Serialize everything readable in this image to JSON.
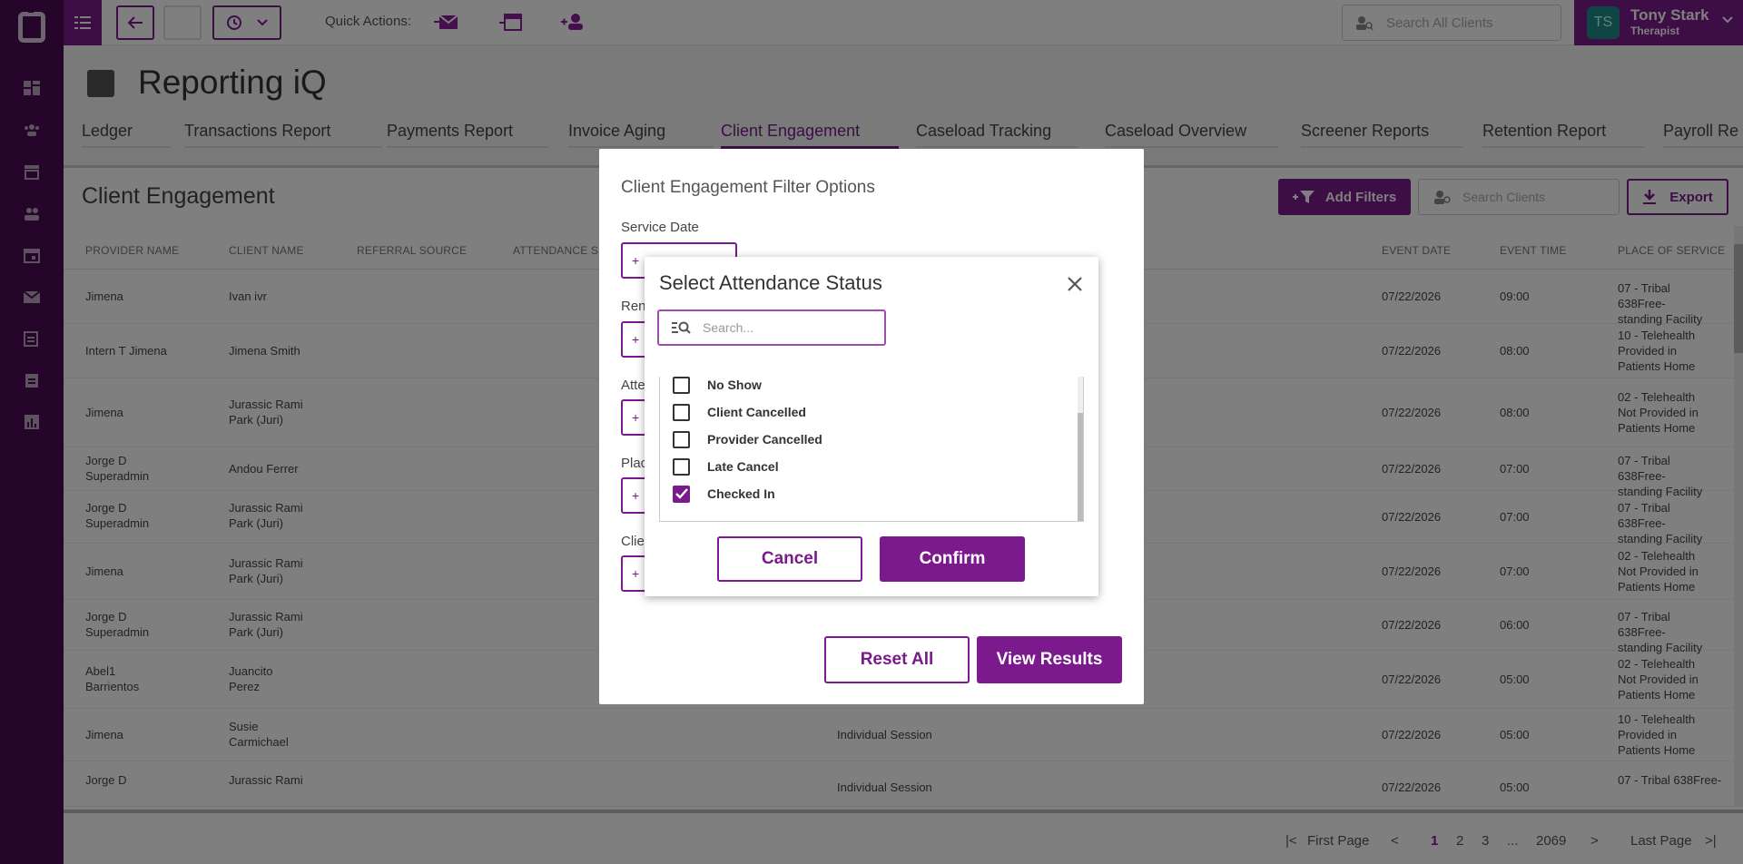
{
  "topbar": {
    "quick_actions_label": "Quick Actions:",
    "search_placeholder": "Search All Clients",
    "user": {
      "initials": "TS",
      "name": "Tony Stark",
      "role": "Therapist"
    }
  },
  "page": {
    "title": "Reporting iQ",
    "tabs": [
      "Ledger",
      "Transactions Report",
      "Payments Report",
      "Invoice Aging",
      "Client Engagement",
      "Caseload Tracking",
      "Caseload Overview",
      "Screener Reports",
      "Retention Report",
      "Payroll Re"
    ],
    "active_tab": "Client Engagement"
  },
  "card": {
    "title": "Client Engagement",
    "add_filters_label": "Add Filters",
    "search_placeholder": "Search Clients",
    "export_label": "Export"
  },
  "table": {
    "headers": [
      "PROVIDER NAME",
      "CLIENT NAME",
      "REFERRAL SOURCE",
      "ATTENDANCE S",
      "EVENT DATE",
      "EVENT TIME",
      "PLACE OF SERVICE"
    ],
    "rows": [
      {
        "provider": "Jimena",
        "client": "Ivan ivr",
        "event": "",
        "date": "07/22/2026",
        "time": "09:00",
        "place": "07 - Tribal 638Free-standing Facility"
      },
      {
        "provider": "Intern T Jimena",
        "client": "Jimena Smith",
        "event": "",
        "date": "07/22/2026",
        "time": "08:00",
        "place": "10 - Telehealth Provided in Patients Home"
      },
      {
        "provider": "Jimena",
        "client": "Jurassic Rami Park (Juri)",
        "event": "",
        "date": "07/22/2026",
        "time": "08:00",
        "place": "02 - Telehealth Not Provided in Patients Home"
      },
      {
        "provider": "Jorge D Superadmin",
        "client": "Andou Ferrer",
        "event": "",
        "date": "07/22/2026",
        "time": "07:00",
        "place": "07 - Tribal 638Free-standing Facility"
      },
      {
        "provider": "Jorge D Superadmin",
        "client": "Jurassic Rami Park (Juri)",
        "event": "",
        "date": "07/22/2026",
        "time": "07:00",
        "place": "07 - Tribal 638Free-standing Facility"
      },
      {
        "provider": "Jimena",
        "client": "Jurassic Rami Park (Juri)",
        "event": "",
        "date": "07/22/2026",
        "time": "07:00",
        "place": "02 - Telehealth Not Provided in Patients Home"
      },
      {
        "provider": "Jorge D Superadmin",
        "client": "Jurassic Rami Park (Juri)",
        "event": "",
        "date": "07/22/2026",
        "time": "06:00",
        "place": "07 - Tribal 638Free-standing Facility"
      },
      {
        "provider": "Abel1 Barrientos",
        "client": "Juancito Perez",
        "event": "",
        "date": "07/22/2026",
        "time": "05:00",
        "place": "02 - Telehealth Not Provided in Patients Home"
      },
      {
        "provider": "Jimena",
        "client": "Susie Carmichael",
        "event": "Individual Session",
        "date": "07/22/2026",
        "time": "05:00",
        "place": "10 - Telehealth Provided in Patients Home"
      },
      {
        "provider": "Jorge D",
        "client": "Jurassic Rami",
        "event": "Individual Session",
        "date": "07/22/2026",
        "time": "05:00",
        "place": "07 - Tribal 638Free-"
      }
    ]
  },
  "pager": {
    "first": "First Page",
    "pages": [
      "1",
      "2",
      "3"
    ],
    "ellipsis": "...",
    "last_num": "2069",
    "last": "Last Page"
  },
  "filter_modal": {
    "title": "Client Engagement Filter Options",
    "labels": [
      "Service Date",
      "Reno",
      "Atte",
      "Plac",
      "Clie"
    ],
    "reset_label": "Reset All",
    "view_label": "View Results"
  },
  "attendance_modal": {
    "title": "Select Attendance Status",
    "search_placeholder": "Search...",
    "options": [
      {
        "label": "No Show",
        "checked": false
      },
      {
        "label": "Client Cancelled",
        "checked": false
      },
      {
        "label": "Provider Cancelled",
        "checked": false
      },
      {
        "label": "Late Cancel",
        "checked": false
      },
      {
        "label": "Checked In",
        "checked": true
      }
    ],
    "cancel_label": "Cancel",
    "confirm_label": "Confirm"
  },
  "colors": {
    "brand": "#7a1a8c",
    "nav": "#4d0a57"
  }
}
